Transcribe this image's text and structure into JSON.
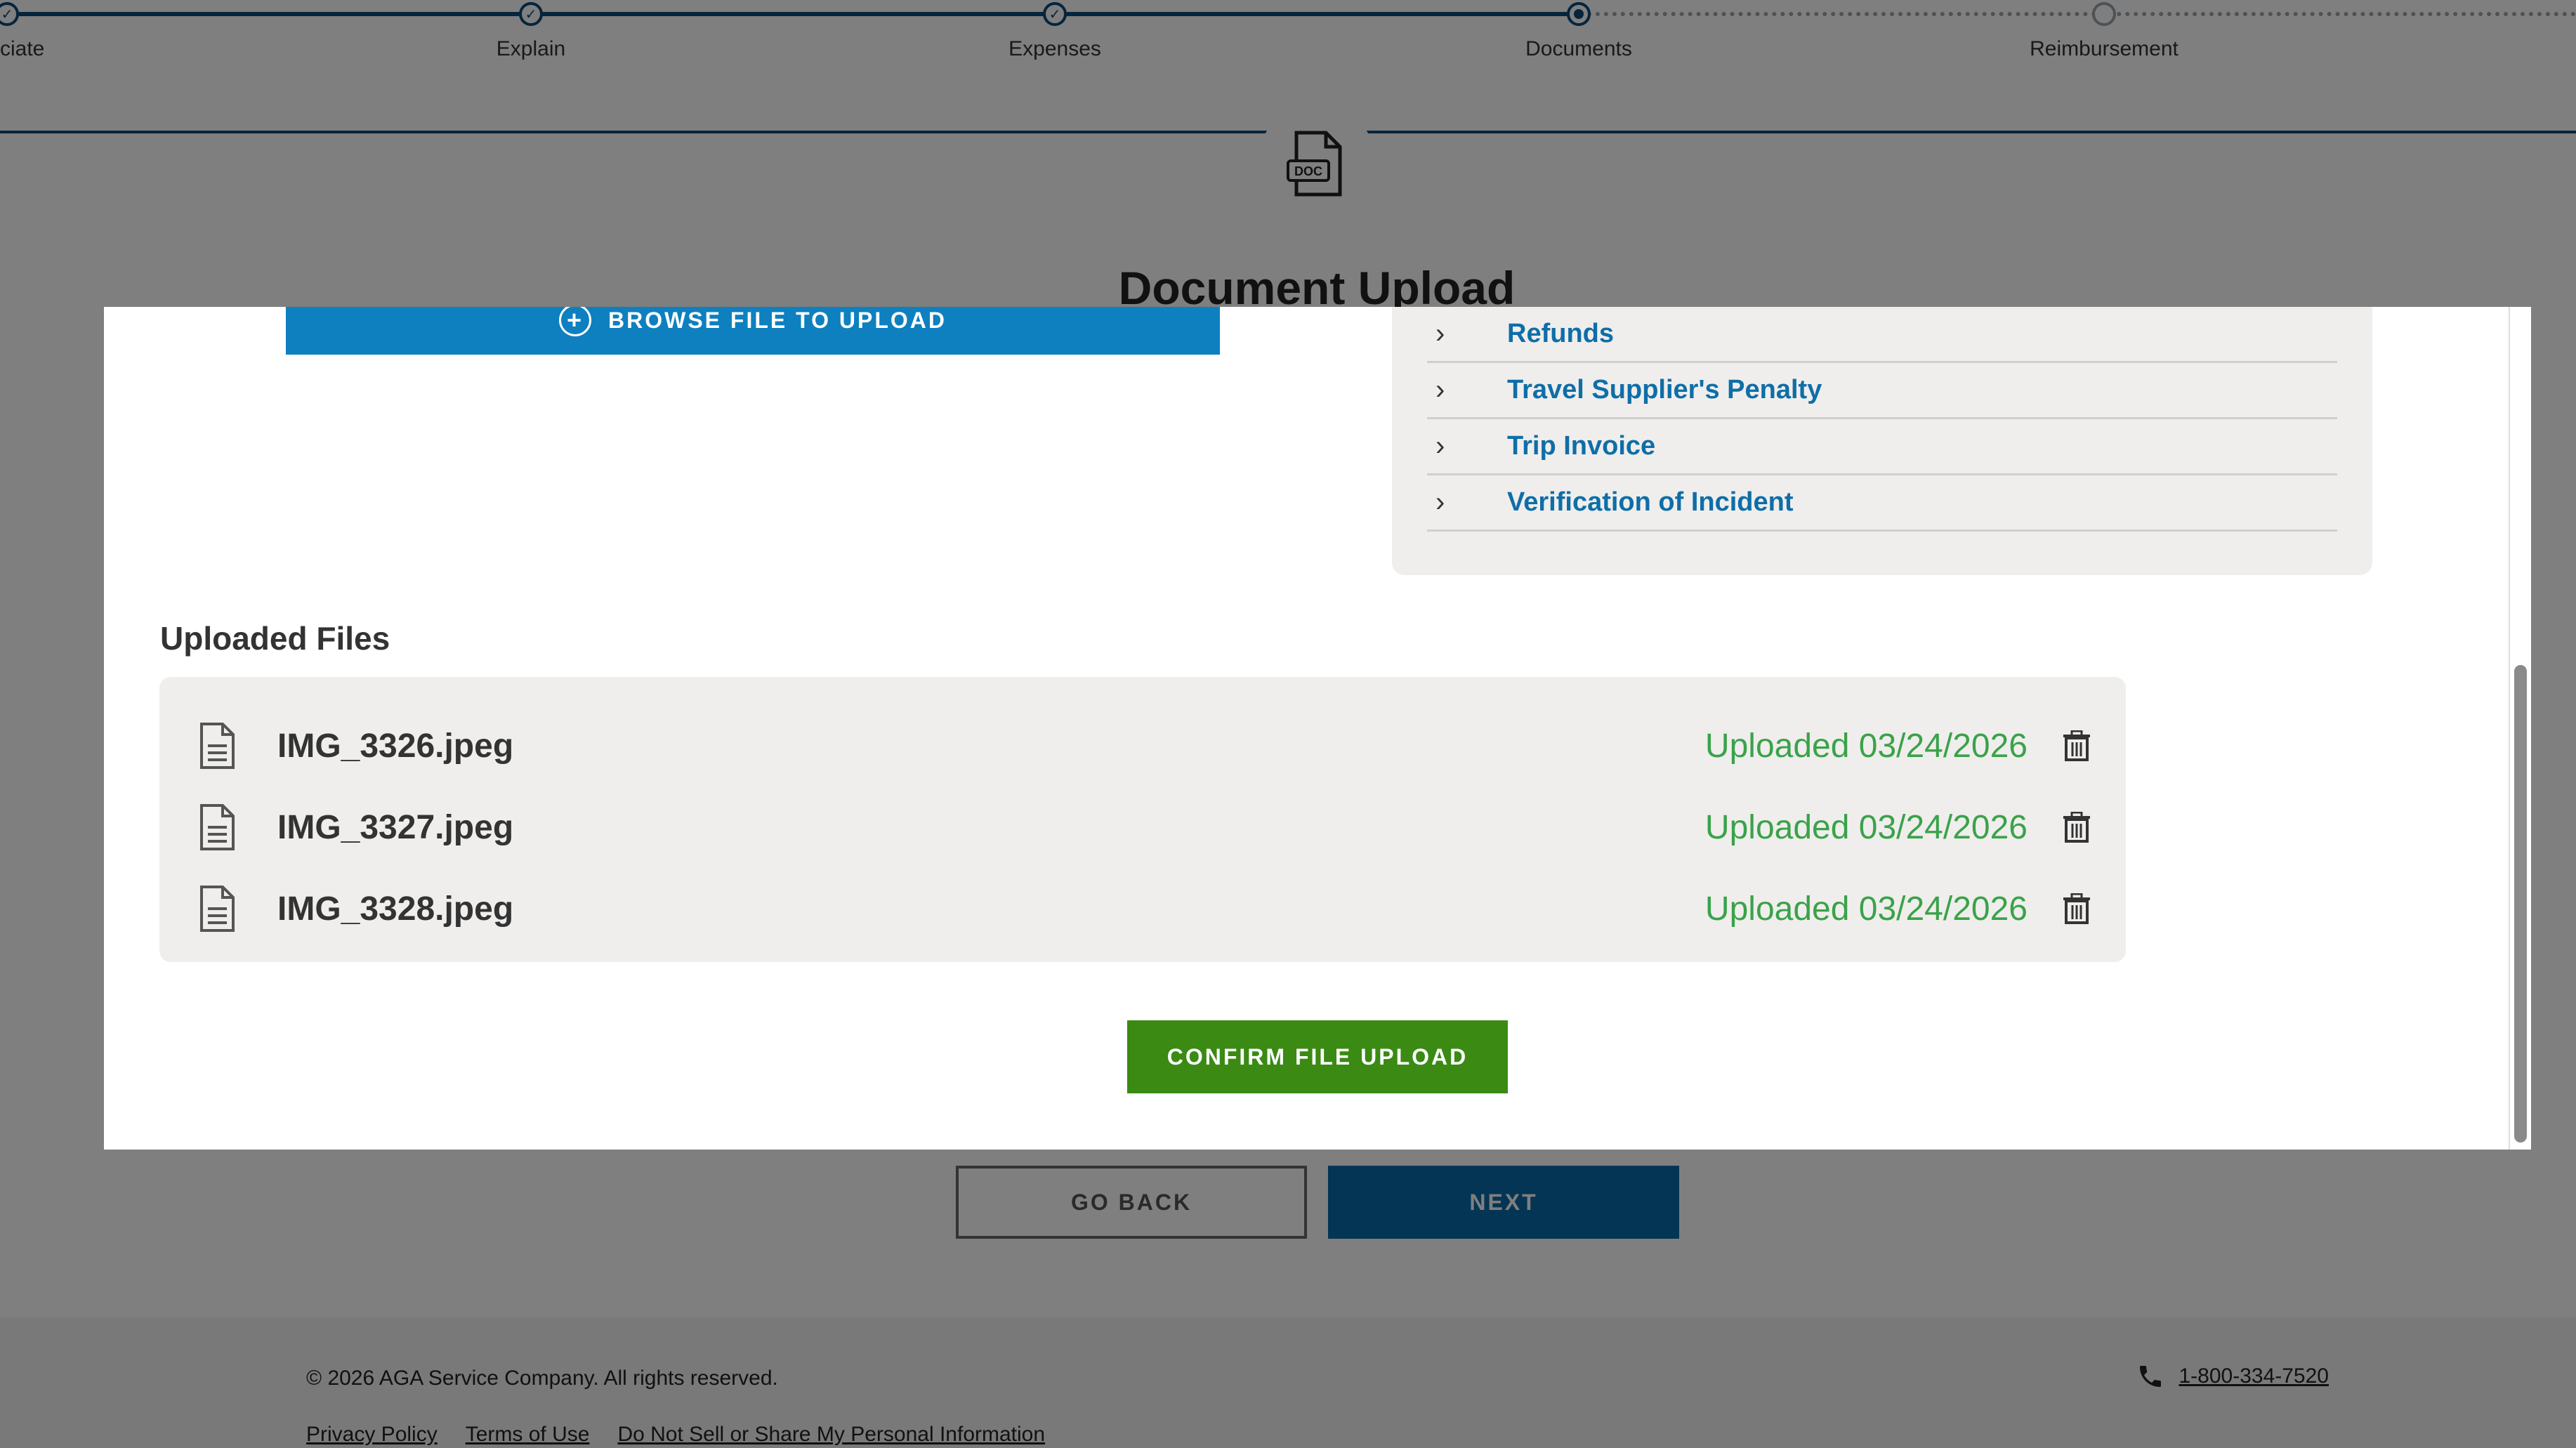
{
  "stepper": {
    "steps": [
      {
        "label": "ciate",
        "state": "done"
      },
      {
        "label": "Explain",
        "state": "done"
      },
      {
        "label": "Expenses",
        "state": "done"
      },
      {
        "label": "Documents",
        "state": "current"
      },
      {
        "label": "Reimbursement",
        "state": "pending"
      }
    ]
  },
  "header": {
    "badge_icon": "doc-icon",
    "badge_text": "DOC",
    "title": "Document Upload"
  },
  "modal": {
    "browse_button": "BROWSE FILE TO UPLOAD",
    "document_types": [
      "Refunds",
      "Travel Supplier's Penalty",
      "Trip Invoice",
      "Verification of Incident"
    ],
    "uploaded_title": "Uploaded Files",
    "files": [
      {
        "name": "IMG_3326.jpeg",
        "status": "Uploaded 03/24/2026"
      },
      {
        "name": "IMG_3327.jpeg",
        "status": "Uploaded 03/24/2026"
      },
      {
        "name": "IMG_3328.jpeg",
        "status": "Uploaded 03/24/2026"
      }
    ],
    "confirm_button": "CONFIRM FILE UPLOAD"
  },
  "nav": {
    "back": "GO BACK",
    "next": "NEXT"
  },
  "footer": {
    "copyright": "© 2026 AGA Service Company.  All rights reserved.",
    "phone": "1-800-334-7520",
    "links": [
      "Privacy Policy",
      "Terms of Use",
      "Do Not Sell or Share My Personal Information"
    ]
  },
  "colors": {
    "primary": "#0e80c0",
    "confirm": "#3a8a14",
    "success": "#3aa24a",
    "link": "#0e6ea8"
  }
}
